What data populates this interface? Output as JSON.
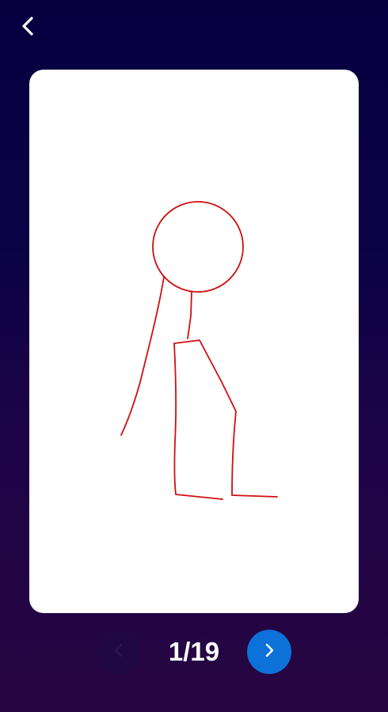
{
  "colors": {
    "background_top": "#06003f",
    "background_bottom": "#280542",
    "card": "#ffffff",
    "stroke": "#d10f0f",
    "next_button": "#0c71d9",
    "prev_button": "#200844"
  },
  "header": {
    "back_icon": "chevron-left-icon"
  },
  "drawing": {
    "subject": "stick-figure",
    "stroke_color": "#d10f0f"
  },
  "pager": {
    "counter": "1/19",
    "current": 1,
    "total": 19,
    "prev_icon": "chevron-left-icon",
    "prev_enabled": false,
    "next_icon": "chevron-right-icon",
    "next_enabled": true
  }
}
